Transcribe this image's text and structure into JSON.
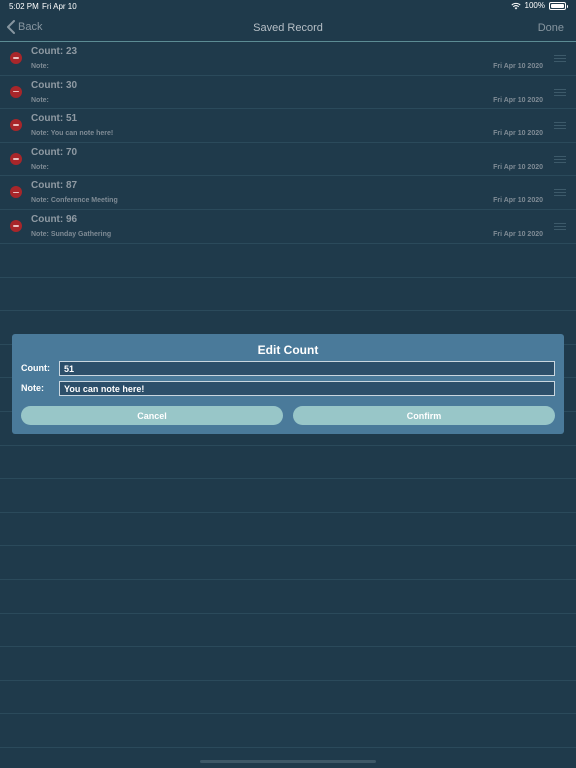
{
  "status_bar": {
    "time": "5:02 PM",
    "date": "Fri Apr 10",
    "battery": "100%",
    "battery_level": 1.0
  },
  "nav": {
    "back_label": "Back",
    "title": "Saved Record",
    "done_label": "Done"
  },
  "records": [
    {
      "count": "Count: 23",
      "note": "Note:",
      "date": "Fri Apr 10 2020"
    },
    {
      "count": "Count: 30",
      "note": "Note:",
      "date": "Fri Apr 10 2020"
    },
    {
      "count": "Count: 51",
      "note": "Note: You can note here!",
      "date": "Fri Apr 10 2020"
    },
    {
      "count": "Count: 70",
      "note": "Note:",
      "date": "Fri Apr 10 2020"
    },
    {
      "count": "Count: 87",
      "note": "Note: Conference Meeting",
      "date": "Fri Apr 10 2020"
    },
    {
      "count": "Count: 96",
      "note": "Note: Sunday Gathering",
      "date": "Fri Apr 10 2020"
    }
  ],
  "dialog": {
    "title": "Edit Count",
    "count_label": "Count:",
    "count_value": "51",
    "note_label": "Note:",
    "note_value": "You can note here!",
    "cancel_label": "Cancel",
    "confirm_label": "Confirm"
  },
  "colors": {
    "background": "#1f3a4b",
    "dialog": "#4a7a9a",
    "button": "#98c6c8",
    "delete": "#a8262a"
  }
}
